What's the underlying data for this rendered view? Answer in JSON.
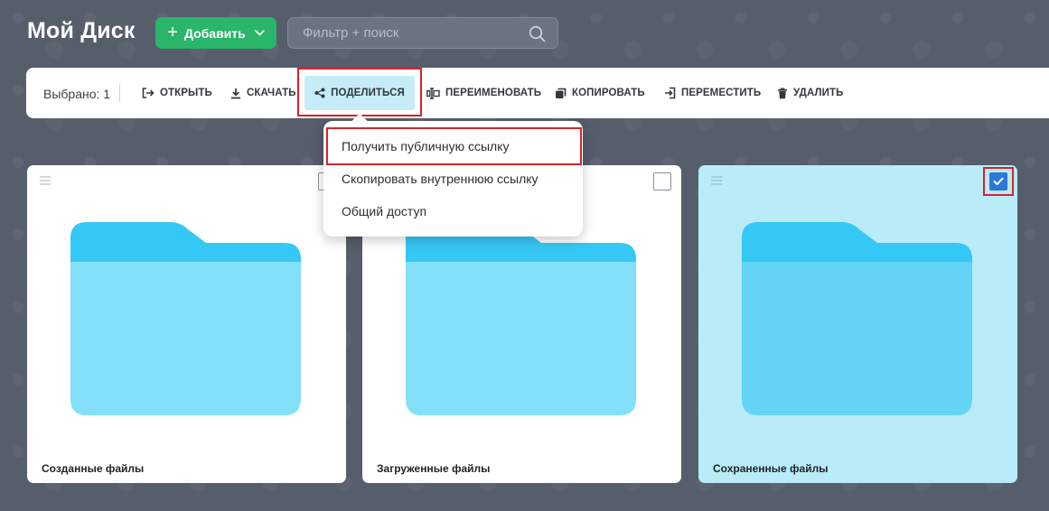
{
  "header": {
    "title": "Мой Диск",
    "add_button_label": "Добавить",
    "search_placeholder": "Фильтр + поиск"
  },
  "toolbar": {
    "selected_text": "Выбрано: 1",
    "open": "ОТКРЫТЬ",
    "download": "СКАЧАТЬ",
    "share": "ПОДЕЛИТЬСЯ",
    "rename": "ПЕРЕИМЕНОВАТЬ",
    "copy": "КОПИРОВАТЬ",
    "move": "ПЕРЕМЕСТИТЬ",
    "delete": "УДАЛИТЬ"
  },
  "share_menu": {
    "items": [
      {
        "label": "Получить публичную ссылку"
      },
      {
        "label": "Скопировать внутреннюю ссылку"
      },
      {
        "label": "Общий доступ"
      }
    ]
  },
  "folders": [
    {
      "name": "Созданные файлы",
      "checked": false
    },
    {
      "name": "Загруженные файлы",
      "checked": false
    },
    {
      "name": "Сохраненные файлы",
      "checked": true
    }
  ],
  "colors": {
    "accent_green": "#2ab56a",
    "share_active_bg": "#c6ecf8",
    "selected_card_bg": "#b9ebf8",
    "checkbox_checked": "#2a78d8",
    "highlight_red": "#d9222a",
    "folder_tab": "#36c8f4",
    "folder_body": "#84e0f9"
  }
}
